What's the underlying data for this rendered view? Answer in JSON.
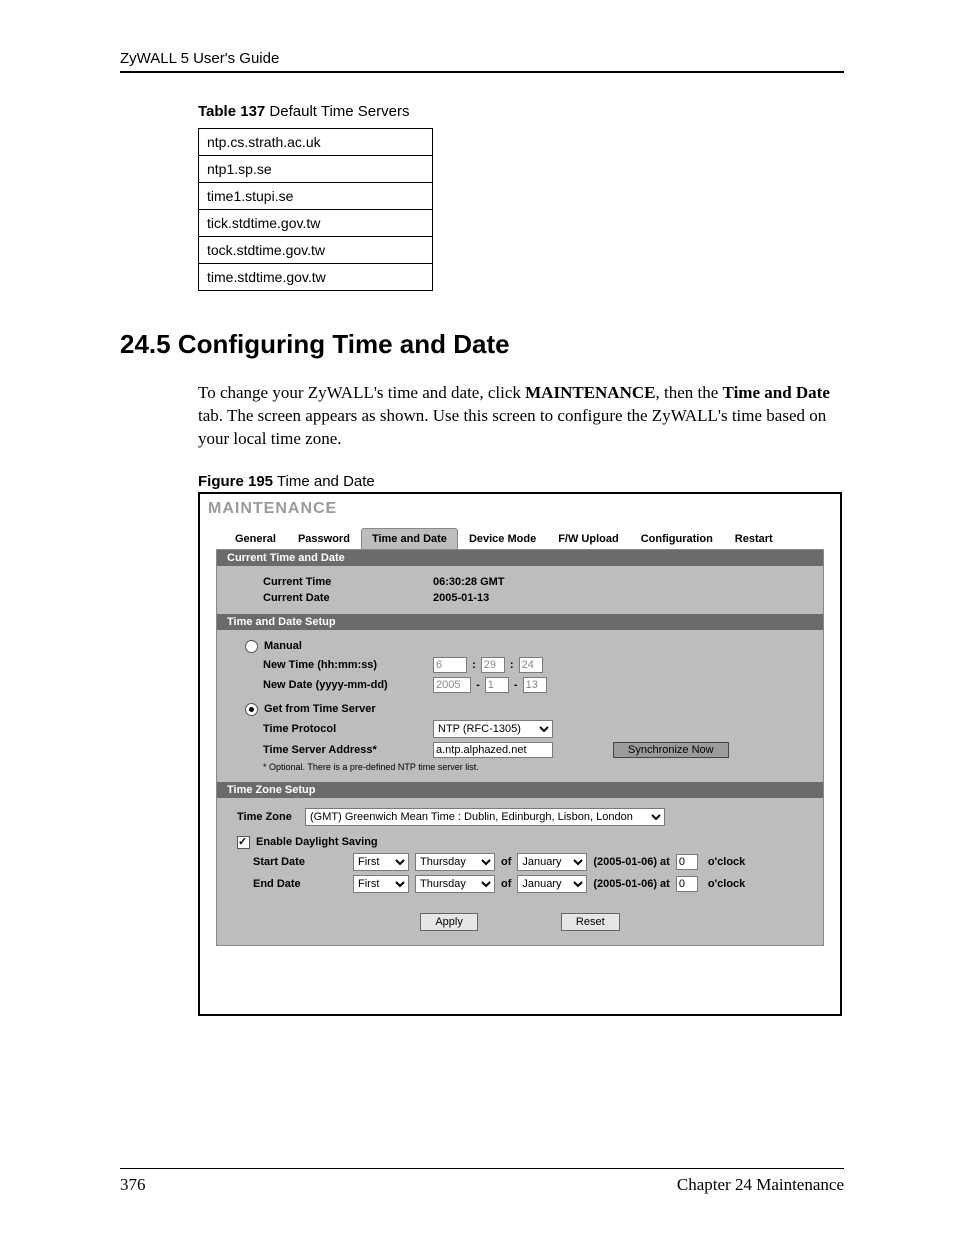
{
  "header": {
    "guide_title": "ZyWALL 5 User's Guide"
  },
  "table137": {
    "label_num": "Table 137",
    "label_text": "  Default Time Servers",
    "rows": [
      "ntp.cs.strath.ac.uk",
      "ntp1.sp.se",
      "time1.stupi.se",
      "tick.stdtime.gov.tw",
      "tock.stdtime.gov.tw",
      "time.stdtime.gov.tw"
    ]
  },
  "section": {
    "heading": "24.5  Configuring Time and Date",
    "body_prefix": "To change your ZyWALL's time and date, click ",
    "body_b1": "MAINTENANCE",
    "body_mid": ", then the ",
    "body_b2": "Time and Date",
    "body_suffix": " tab. The screen appears as shown. Use this screen to configure the ZyWALL's time based on your local time zone."
  },
  "figure_caption": {
    "num": "Figure 195",
    "text": "  Time and Date"
  },
  "fig": {
    "title": "MAINTENANCE",
    "tabs": [
      "General",
      "Password",
      "Time and Date",
      "Device Mode",
      "F/W Upload",
      "Configuration",
      "Restart"
    ],
    "sectionbars": {
      "current": "Current Time and Date",
      "setup": "Time and Date Setup",
      "tz": "Time Zone Setup"
    },
    "current": {
      "labels": {
        "time": "Current Time",
        "date": "Current Date"
      },
      "values": {
        "time": "06:30:28  GMT",
        "date": "2005-01-13"
      }
    },
    "setup": {
      "manual_label": "Manual",
      "newtime_label": "New Time (hh:mm:ss)",
      "newtime": {
        "h": "6",
        "m": "29",
        "s": "24"
      },
      "newdate_label": "New Date (yyyy-mm-dd)",
      "newdate": {
        "y": "2005",
        "mo": "1",
        "d": "13"
      },
      "fromserver_label": "Get from Time Server",
      "protocol_label": "Time Protocol",
      "protocol_value": "NTP (RFC-1305)",
      "addr_label": "Time Server Address*",
      "addr_value": "a.ntp.alphazed.net",
      "sync_btn": "Synchronize Now",
      "footnote": "* Optional. There is a pre-defined NTP time server list."
    },
    "tz": {
      "tz_label": "Time Zone",
      "tz_value": "(GMT) Greenwich Mean Time : Dublin, Edinburgh, Lisbon, London",
      "dst_label": "Enable Daylight Saving",
      "start_label": "Start Date",
      "end_label": "End Date",
      "ordinal": "First",
      "weekday": "Thursday",
      "of": "of",
      "month": "January",
      "dateparen": "(2005-01-06)  at",
      "hour": "0",
      "oclock": "o'clock"
    },
    "buttons": {
      "apply": "Apply",
      "reset": "Reset"
    }
  },
  "footer": {
    "page": "376",
    "chapter": "Chapter 24 Maintenance"
  }
}
